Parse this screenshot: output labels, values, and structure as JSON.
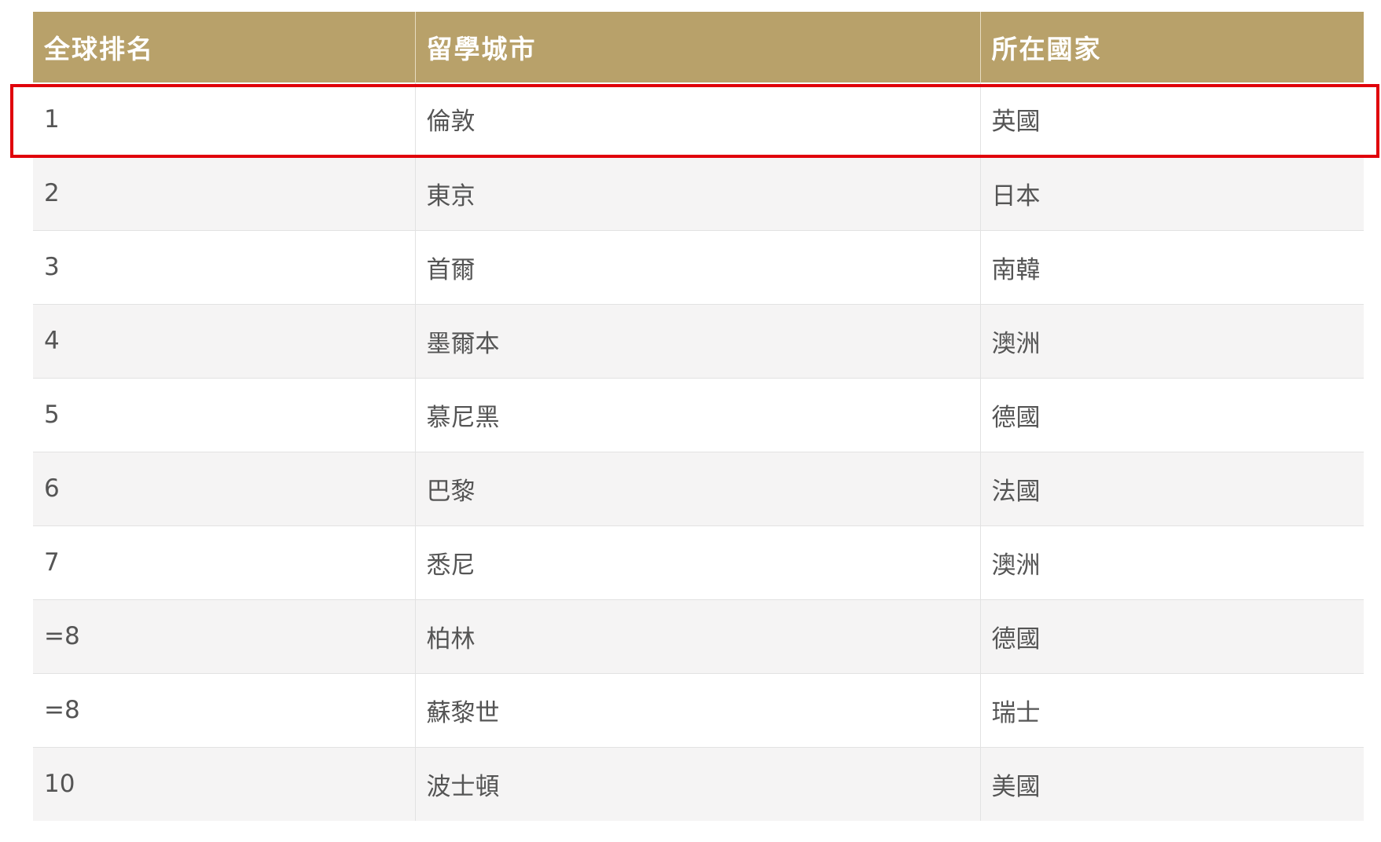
{
  "table": {
    "headers": [
      "全球排名",
      "留學城市",
      "所在國家"
    ],
    "rows": [
      [
        "1",
        "倫敦",
        "英國"
      ],
      [
        "2",
        "東京",
        "日本"
      ],
      [
        "3",
        "首爾",
        "南韓"
      ],
      [
        "4",
        "墨爾本",
        "澳洲"
      ],
      [
        "5",
        "慕尼黑",
        "德國"
      ],
      [
        "6",
        "巴黎",
        "法國"
      ],
      [
        "7",
        "悉尼",
        "澳洲"
      ],
      [
        "=8",
        "柏林",
        "德國"
      ],
      [
        "=8",
        "蘇黎世",
        "瑞士"
      ],
      [
        "10",
        "波士頓",
        "美國"
      ]
    ]
  },
  "highlight": {
    "row": 0,
    "color": "#e0000a"
  },
  "colors": {
    "header_bg": "#b8a16a",
    "header_text": "#ffffff",
    "row_alt_bg": "#f5f4f4",
    "cell_text": "#555555"
  }
}
